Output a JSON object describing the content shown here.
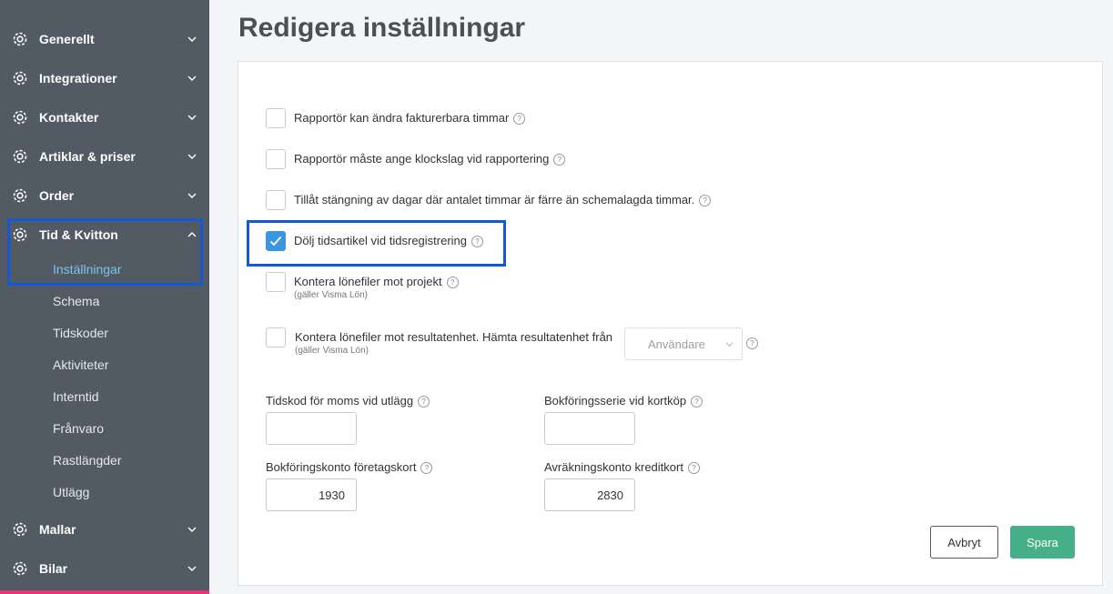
{
  "sidebar": {
    "items": [
      {
        "label": "Generellt"
      },
      {
        "label": "Integrationer"
      },
      {
        "label": "Kontakter"
      },
      {
        "label": "Artiklar & priser"
      },
      {
        "label": "Order"
      },
      {
        "label": "Tid & Kvitton"
      },
      {
        "label": "Mallar"
      },
      {
        "label": "Bilar"
      }
    ],
    "subitems": [
      {
        "label": "Inställningar"
      },
      {
        "label": "Schema"
      },
      {
        "label": "Tidskoder"
      },
      {
        "label": "Aktiviteter"
      },
      {
        "label": "Interntid"
      },
      {
        "label": "Frånvaro"
      },
      {
        "label": "Rastlängder"
      },
      {
        "label": "Utlägg"
      }
    ]
  },
  "page": {
    "title": "Redigera inställningar"
  },
  "checkboxes": [
    {
      "label": "Rapportör kan ändra fakturerbara timmar",
      "checked": false
    },
    {
      "label": "Rapportör måste ange klockslag vid rapportering",
      "checked": false
    },
    {
      "label": "Tillåt stängning av dagar där antalet timmar är färre än schemalagda timmar.",
      "checked": false
    },
    {
      "label": "Dölj tidsartikel vid tidsregistrering",
      "checked": true
    },
    {
      "label": "Kontera lönefiler mot projekt",
      "sublabel": "(gäller Visma Lön)",
      "checked": false
    },
    {
      "label": "Kontera lönefiler mot resultatenhet. Hämta resultatenhet från",
      "sublabel": "(gäller Visma Lön)",
      "checked": false
    }
  ],
  "resultatenhet_select": {
    "value": "Användare"
  },
  "help_glyph": "?",
  "fields": {
    "tidskod_moms": {
      "label": "Tidskod för moms vid utlägg",
      "value": ""
    },
    "bokforingsserie": {
      "label": "Bokföringsserie vid kortköp",
      "value": ""
    },
    "bokforingskonto": {
      "label": "Bokföringskonto företagskort",
      "value": "1930"
    },
    "avrakningskonto": {
      "label": "Avräkningskonto kreditkort",
      "value": "2830"
    }
  },
  "buttons": {
    "cancel": "Avbryt",
    "save": "Spara"
  },
  "colors": {
    "sidebar": "#525a63",
    "accent": "#3b96e0",
    "save": "#47b08a",
    "highlight": "#1558d6",
    "active_sub": "#7cc3ee"
  }
}
